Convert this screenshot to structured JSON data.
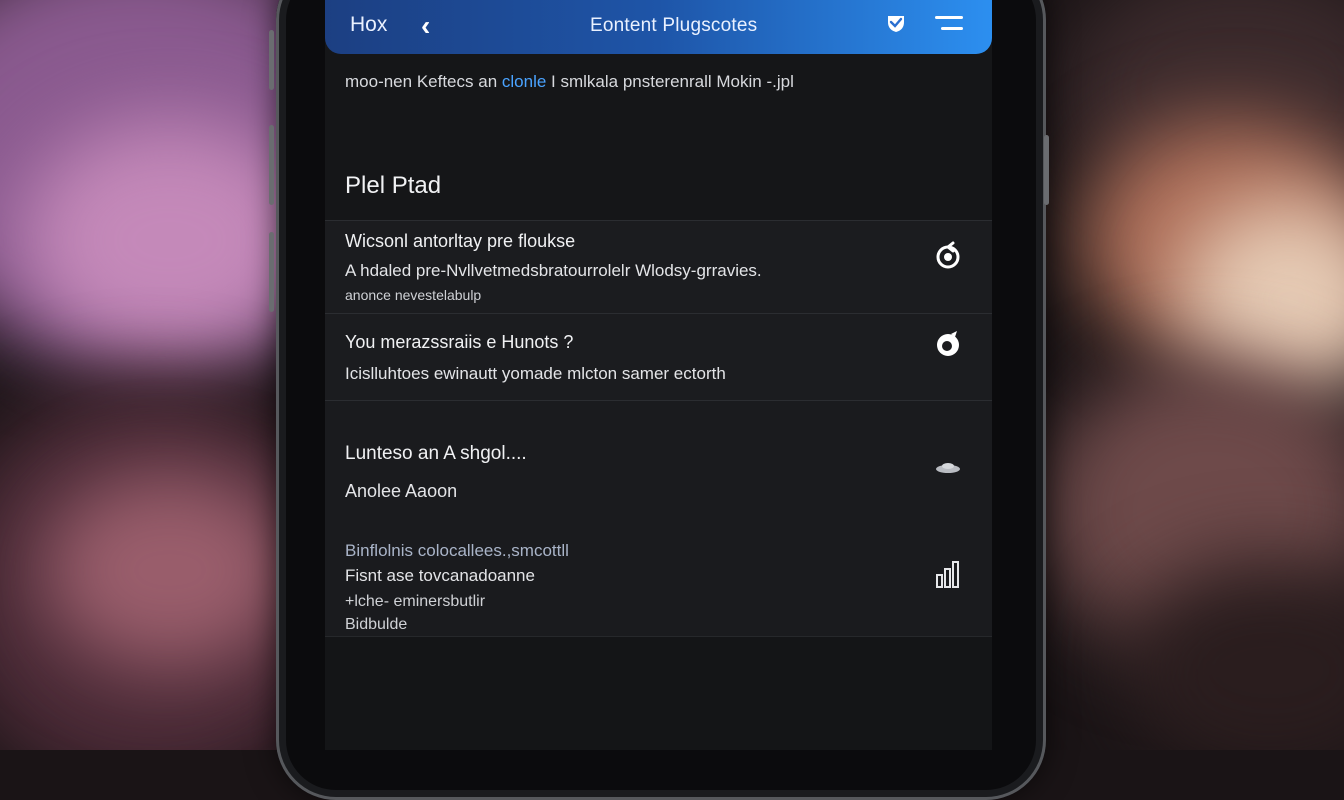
{
  "app_bar": {
    "logo": "Hoх",
    "back_glyph": "‹",
    "title": "Eontent  Plugscotes"
  },
  "subtitle": {
    "part1": "moo-nen Keftecs an",
    "accent": "clonle",
    "part2": "I smlkala pnsterenrall Mokin -.jpl"
  },
  "section_title": "Plel Ptad",
  "items": [
    {
      "title": "Wicsonl antorltay pre floukse",
      "line2": "A hdaled pre-Nvllvetmedsbratourrolelr Wlodsy-grravies.",
      "line3": "anonce nevestelabulp",
      "icon": "refresh-icon"
    },
    {
      "title": "You merazssraiis e Hunots  ?",
      "line2": "Icislluhtoes ewinautt yomade mlcton samer ectorth",
      "icon": "settings-icon"
    },
    {
      "title": "Lunteso an A shgol....",
      "line2": "Anolee Aaoon",
      "icon": "cloud-icon",
      "subtitle_accent": "Binflolnis colocallees.,smcottll",
      "line3": "Fisnt ase tovcanadoanne",
      "line4": "+lche- eminersbutlir",
      "line5": "Bidbulde"
    }
  ],
  "colors": {
    "accent": "#4aa3ff",
    "appbar_start": "#1c3f82",
    "appbar_end": "#2c8ff0"
  }
}
